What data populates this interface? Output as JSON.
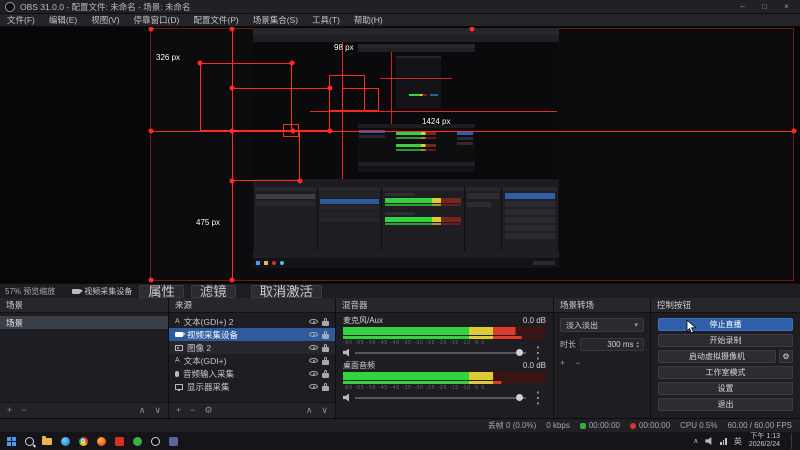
{
  "window": {
    "title": "OBS 31.0.0 - 配置文件: 未命名 - 场景: 未命名",
    "menus": [
      "文件(F)",
      "编辑(E)",
      "视图(V)",
      "停靠窗口(D)",
      "配置文件(P)",
      "场景集合(S)",
      "工具(T)",
      "帮助(H)"
    ]
  },
  "icons": {
    "minimize": "–",
    "maximize": "□",
    "close": "×",
    "plus": "+",
    "minus": "−",
    "gear": "⚙",
    "chevron_up": "∧",
    "chevron_down": "∨",
    "caret_down": "▾",
    "dots": "⋮",
    "spin_up": "▴",
    "spin_down": "▾",
    "text_source": "A",
    "tray_chevron": "∧"
  },
  "preview": {
    "zoom_label": "57% 预览缩放",
    "dimension_labels": {
      "a": "326 px",
      "b": "98 px",
      "c": "1424 px",
      "d": "475 px"
    }
  },
  "context_bar": {
    "source_label": "视频采集设备",
    "properties": "属性",
    "filters": "滤镜",
    "deactivate": "取消激活"
  },
  "panels": {
    "scenes": {
      "title": "场景",
      "items": [
        {
          "label": "场景"
        }
      ]
    },
    "sources": {
      "title": "来源",
      "items": [
        {
          "name": "文本(GDI+) 2",
          "type": "text"
        },
        {
          "name": "视频采集设备",
          "type": "camera",
          "selected": true
        },
        {
          "name": "图像 2",
          "type": "image"
        },
        {
          "name": "文本(GDI+)",
          "type": "text"
        },
        {
          "name": "音频输入采集",
          "type": "mic"
        },
        {
          "name": "显示器采集",
          "type": "monitor"
        }
      ]
    },
    "mixer": {
      "title": "混音器",
      "channels": [
        {
          "name": "麦克风/Aux",
          "value": "0.0 dB",
          "scale": "-60 -55 -50 -45 -40 -35 -30 -25 -20 -15 -10 -5 0"
        },
        {
          "name": "桌面音频",
          "value": "0.0 dB",
          "scale": "-60 -55 -50 -45 -40 -35 -30 -25 -20 -15 -10 -5 0"
        }
      ]
    },
    "transitions": {
      "title": "场景转场",
      "selected": "淡入淡出",
      "duration_label": "时长",
      "duration_value": "300 ms"
    },
    "controls": {
      "title": "控制按钮",
      "buttons": [
        "停止直播",
        "开始录制",
        "启动虚拟摄像机",
        "工作室模式",
        "设置",
        "退出"
      ]
    }
  },
  "status_bar": {
    "dropped_frames": "丢帧 0 (0.0%)",
    "bitrate": "0 kbps",
    "stream_time": "00:00:00",
    "record_time": "00:00:00",
    "cpu": "CPU 0.5%",
    "fps": "60.00 / 60.00 FPS"
  },
  "taskbar": {
    "language": "英",
    "time": "下午 1:13",
    "date": "2026/2/24"
  },
  "colors": {
    "accent_blue": "#2e5fa8",
    "selection_red": "#ff2a22",
    "meter_green": "#33d33f",
    "meter_yellow": "#ddcb33",
    "meter_red": "#e03a2e",
    "live_green": "#2fae3c",
    "record_red": "#d23b33"
  }
}
